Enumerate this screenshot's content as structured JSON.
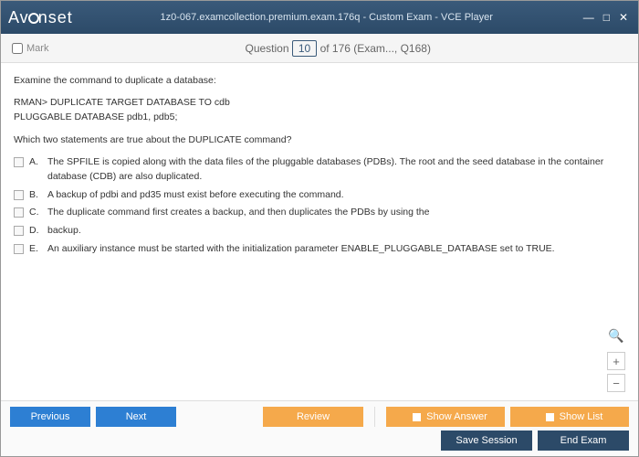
{
  "titlebar": {
    "logo_text": "Avanset",
    "title": "1z0-067.examcollection.premium.exam.176q - Custom Exam - VCE Player"
  },
  "subheader": {
    "mark_label": "Mark",
    "question_prefix": "Question",
    "question_num": "10",
    "question_suffix": "of 176 (Exam..., Q168)"
  },
  "content": {
    "intro": "Examine the command to duplicate a database:",
    "cmd1": "RMAN> DUPLICATE TARGET DATABASE TO cdb",
    "cmd2": "PLUGGABLE DATABASE pdb1, pdb5;",
    "prompt": "Which two statements are true about the DUPLICATE command?"
  },
  "answers": [
    {
      "letter": "A.",
      "text": "The SPFILE is copied along with the data files of the pluggable databases (PDBs). The root and the seed database in the container database (CDB) are also duplicated."
    },
    {
      "letter": "B.",
      "text": "A backup of pdbi and pd35 must exist before executing the command."
    },
    {
      "letter": "C.",
      "text": "The duplicate command first creates a backup, and then duplicates the PDBs by using the"
    },
    {
      "letter": "D.",
      "text": "backup."
    },
    {
      "letter": "E.",
      "text": "An auxiliary instance must be started with the initialization parameter ENABLE_PLUGGABLE_DATABASE set to TRUE."
    }
  ],
  "footer": {
    "previous": "Previous",
    "next": "Next",
    "review": "Review",
    "show_answer": "Show Answer",
    "show_list": "Show List",
    "save_session": "Save Session",
    "end_exam": "End Exam"
  }
}
